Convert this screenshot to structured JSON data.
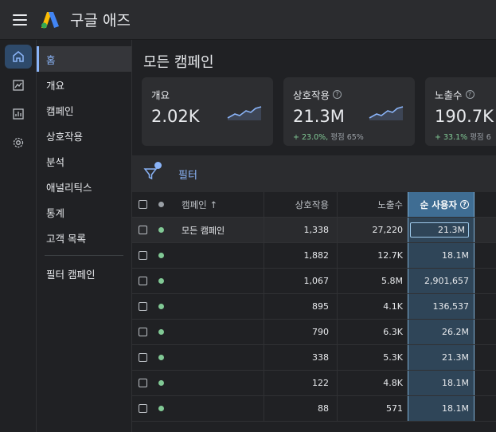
{
  "app": {
    "title": "구글 애즈"
  },
  "colors": {
    "accent": "#8ab4f8",
    "positive": "#81c995",
    "highlight": "#3f6d93"
  },
  "rail": [
    {
      "icon": "home-icon"
    },
    {
      "icon": "chart-icon"
    },
    {
      "icon": "report-icon"
    },
    {
      "icon": "gear-icon"
    }
  ],
  "nav": {
    "items": [
      {
        "label": "홈"
      },
      {
        "label": "개요"
      },
      {
        "label": "캠페인"
      },
      {
        "label": "상호작용"
      },
      {
        "label": "분석"
      },
      {
        "label": "애널리틱스"
      },
      {
        "label": "통계"
      },
      {
        "label": "고객 목록"
      },
      {
        "label": "필터 캠페인"
      }
    ]
  },
  "main": {
    "title": "모든 캠페인",
    "cards": [
      {
        "label": "개요",
        "value": "2.02K",
        "sub_up": "",
        "sub_rest": ""
      },
      {
        "label": "상호작용",
        "value": "21.3M",
        "sub_up": "+ 23.0%,",
        "sub_rest": " 평점 65%"
      },
      {
        "label": "노출수",
        "value": "190.7K",
        "sub_up": "+ 33.1%",
        "sub_rest": " 평점 6"
      }
    ],
    "filter_label": "필터",
    "table": {
      "headers": {
        "name": "캠페인 ↑",
        "interactions": "상호작용",
        "impressions": "노출수",
        "users": "순 사용자"
      },
      "rows": [
        {
          "name": "모든 캠페인",
          "interactions": "1,338",
          "impressions": "27,220",
          "users": "21.3M"
        },
        {
          "name": "",
          "interactions": "1,882",
          "impressions": "12.7K",
          "users": "18.1M"
        },
        {
          "name": "",
          "interactions": "1,067",
          "impressions": "5.8M",
          "users": "2,901,657"
        },
        {
          "name": "",
          "interactions": "895",
          "impressions": "4.1K",
          "users": "136,537"
        },
        {
          "name": "",
          "interactions": "790",
          "impressions": "6.3K",
          "users": "26.2M"
        },
        {
          "name": "",
          "interactions": "338",
          "impressions": "5.3K",
          "users": "21.3M"
        },
        {
          "name": "",
          "interactions": "122",
          "impressions": "4.8K",
          "users": "18.1M"
        },
        {
          "name": "",
          "interactions": "88",
          "impressions": "571",
          "users": "18.1M"
        }
      ]
    }
  }
}
